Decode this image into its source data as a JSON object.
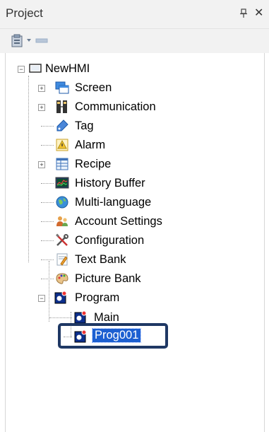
{
  "panel": {
    "title": "Project",
    "pin_icon": "pin-icon",
    "close_icon": "close-icon",
    "close_glyph": "✕"
  },
  "toolbar": {
    "items": [
      {
        "icon": "project-properties-icon"
      },
      {
        "icon": "dropdown-arrow-icon"
      },
      {
        "icon": "collapse-icon"
      }
    ]
  },
  "tree": {
    "root": {
      "label": "NewHMI",
      "icon": "hmi-icon",
      "expanded": true
    },
    "items": [
      {
        "label": "Screen",
        "icon": "screen-icon",
        "expandable": true
      },
      {
        "label": "Communication",
        "icon": "communication-icon",
        "expandable": true
      },
      {
        "label": "Tag",
        "icon": "tag-icon",
        "expandable": false
      },
      {
        "label": "Alarm",
        "icon": "alarm-icon",
        "expandable": false
      },
      {
        "label": "Recipe",
        "icon": "recipe-icon",
        "expandable": true
      },
      {
        "label": "History Buffer",
        "icon": "history-buffer-icon",
        "expandable": false
      },
      {
        "label": "Multi-language",
        "icon": "globe-icon",
        "expandable": false
      },
      {
        "label": "Account Settings",
        "icon": "users-icon",
        "expandable": false
      },
      {
        "label": "Configuration",
        "icon": "tools-icon",
        "expandable": false
      },
      {
        "label": "Text Bank",
        "icon": "text-bank-icon",
        "expandable": false
      },
      {
        "label": "Picture Bank",
        "icon": "palette-icon",
        "expandable": false
      },
      {
        "label": "Program",
        "icon": "program-icon",
        "expandable": true,
        "expanded": true
      }
    ],
    "program_children": [
      {
        "label": "Main",
        "icon": "program-icon"
      },
      {
        "label": "Prog001",
        "icon": "program-icon",
        "selected": true
      }
    ]
  },
  "colors": {
    "selection": "#1c5fd1",
    "highlight_box": "#1f3864"
  }
}
